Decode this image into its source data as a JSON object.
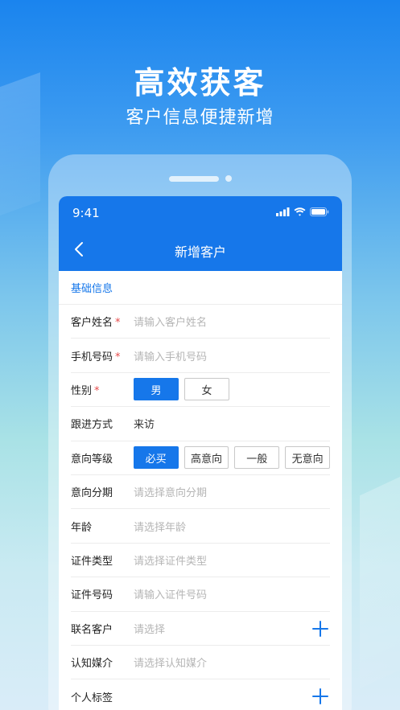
{
  "promo": {
    "title": "高效获客",
    "subtitle": "客户信息便捷新增"
  },
  "status_bar": {
    "time": "9:41"
  },
  "nav": {
    "title": "新增客户"
  },
  "section": {
    "title": "基础信息"
  },
  "fields": {
    "name": {
      "label": "客户姓名",
      "required": "*",
      "placeholder": "请输入客户姓名"
    },
    "phone": {
      "label": "手机号码",
      "required": "*",
      "placeholder": "请输入手机号码"
    },
    "gender": {
      "label": "性别",
      "required": "*",
      "options": [
        "男",
        "女"
      ],
      "selected": "男"
    },
    "followup": {
      "label": "跟进方式",
      "value": "来访"
    },
    "intent_level": {
      "label": "意向等级",
      "options": [
        "必买",
        "高意向",
        "一般",
        "无意向"
      ],
      "selected": "必买"
    },
    "intent_stage": {
      "label": "意向分期",
      "placeholder": "请选择意向分期"
    },
    "age": {
      "label": "年龄",
      "placeholder": "请选择年龄"
    },
    "id_type": {
      "label": "证件类型",
      "placeholder": "请选择证件类型"
    },
    "id_number": {
      "label": "证件号码",
      "placeholder": "请输入证件号码"
    },
    "linked_customer": {
      "label": "联名客户",
      "placeholder": "请选择"
    },
    "media": {
      "label": "认知媒介",
      "placeholder": "请选择认知媒介"
    },
    "tags": {
      "label": "个人标签"
    }
  },
  "colors": {
    "primary": "#1677ea",
    "required": "#e64a4a"
  }
}
